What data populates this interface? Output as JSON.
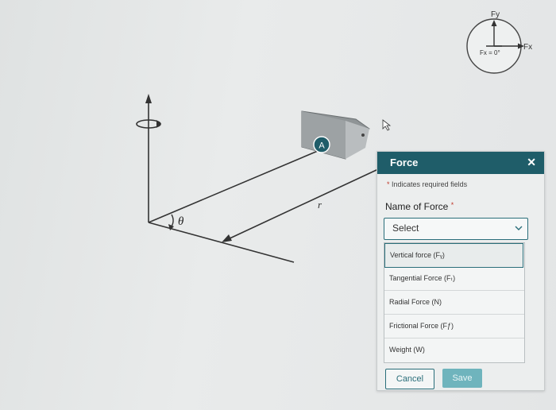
{
  "diagram": {
    "marker_label": "A",
    "theta_label": "θ",
    "r_label": "r",
    "compass": {
      "fy_label": "Fy",
      "fx_label": "Fx",
      "center_label": "Fx = 0°"
    }
  },
  "panel": {
    "title": "Force",
    "required_note": "Indicates required fields",
    "field_label": "Name of Force",
    "select_value": "Select",
    "options": [
      "Vertical force (Fᵧ)",
      "Tangential Force (Fₜ)",
      "Radial Force (N)",
      "Frictional Force (Fƒ)",
      "Weight (W)"
    ],
    "selected_index": 0,
    "cancel_label": "Cancel",
    "save_label": "Save",
    "close_glyph": "✕"
  },
  "colors": {
    "accent": "#1f5d69",
    "save_bg": "#6fb4bd",
    "required": "#c0392b"
  }
}
